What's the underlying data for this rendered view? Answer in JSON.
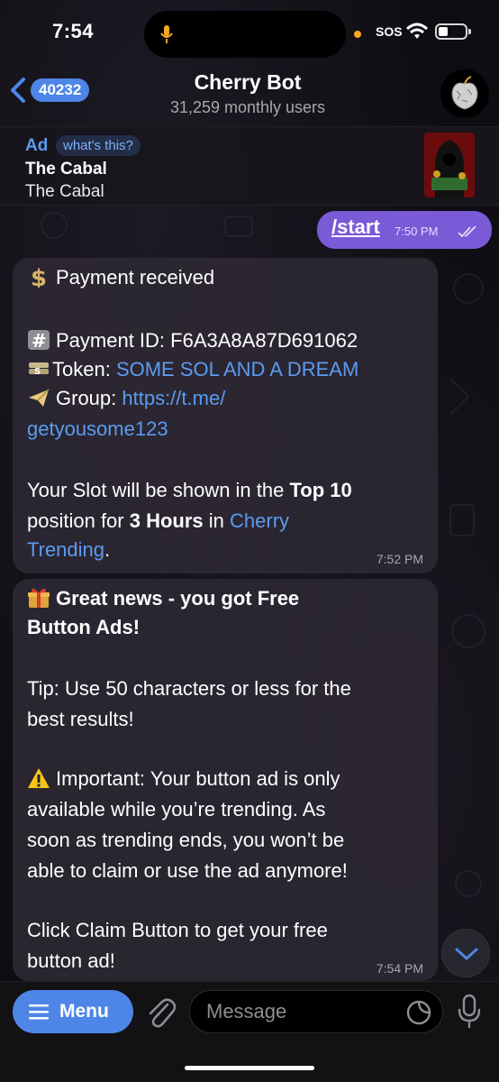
{
  "status_bar": {
    "time": "7:54",
    "carrier_text": "SOS"
  },
  "header": {
    "back_count": "40232",
    "title": "Cherry Bot",
    "subtitle": "31,259 monthly users"
  },
  "ad": {
    "label": "Ad",
    "whats_this": "what's this?",
    "name": "The Cabal",
    "description": "The Cabal"
  },
  "messages": {
    "outgoing": {
      "text": "/start",
      "time": "7:50 PM"
    },
    "payment": {
      "received": "Payment received",
      "payment_id": "Payment ID: F6A3A8A87D691062",
      "token_label": "Token: ",
      "token_value": "SOME SOL AND A DREAM",
      "group_label": "Group: ",
      "group_link_1": "https://t.me/",
      "group_link_2": "getyousome123",
      "slot_1": "Your Slot will be shown in the ",
      "slot_bold_1": "Top 10",
      "slot_2": "position for ",
      "slot_bold_2": "3 Hours",
      "slot_3": " in ",
      "slot_link_1": "Cherry",
      "slot_link_2": "Trending",
      "slot_end": ".",
      "time": "7:52 PM"
    },
    "ads": {
      "headline_1": "Great news - you got Free",
      "headline_2": "Button Ads!",
      "tip_1": "Tip: Use 50 characters or less for the",
      "tip_2": "best results!",
      "important_1": "Important: Your button ad is only",
      "important_2": "available while you’re trending. As",
      "important_3": "soon as trending ends, you won’t be",
      "important_4": "able to claim or use the ad anymore!",
      "claim_1": "Click Claim Button to get your free",
      "claim_2": "button ad!",
      "time": "7:54 PM"
    }
  },
  "input_bar": {
    "menu_label": "Menu",
    "placeholder": "Message"
  },
  "colors": {
    "accent": "#4d86e6",
    "outgoing_bubble": "#7a5ad6",
    "link": "#5b9bf0"
  }
}
